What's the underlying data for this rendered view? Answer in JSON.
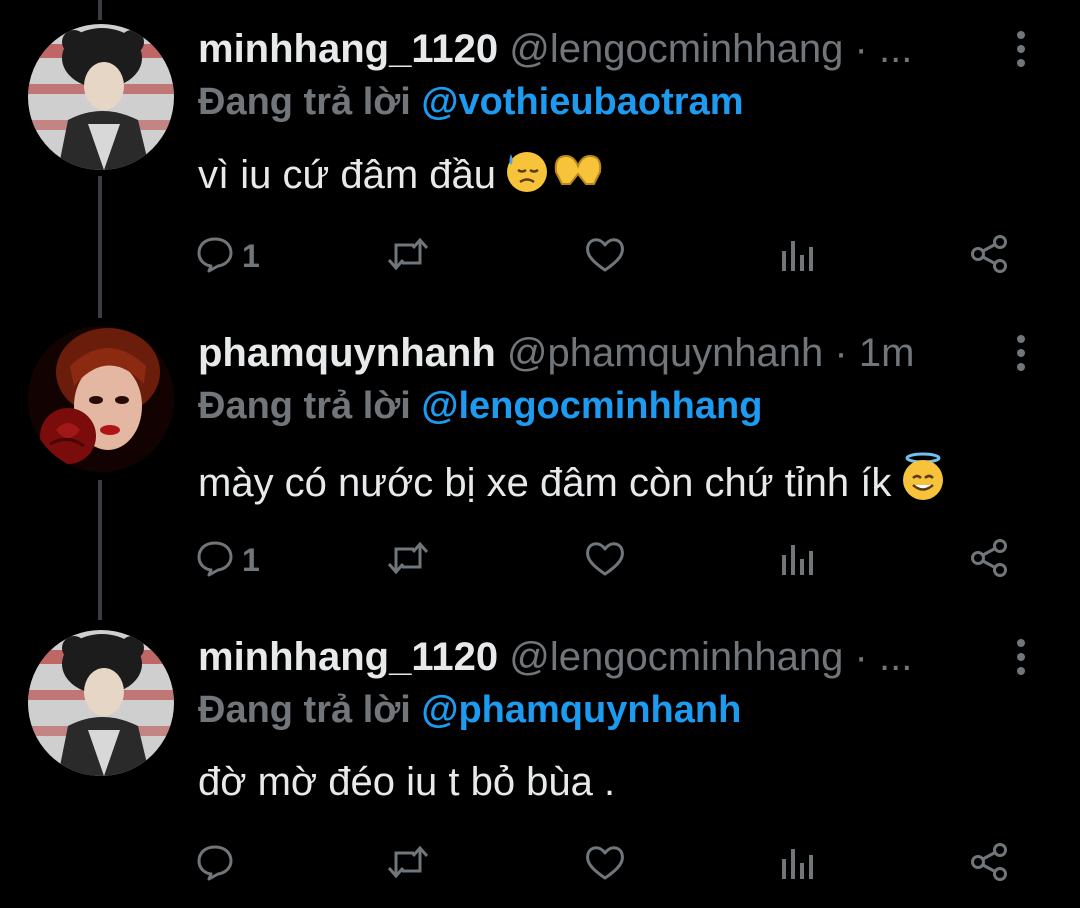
{
  "tweets": [
    {
      "display_name": "minhhang_1120",
      "handle": "@lengocminhhang",
      "separator": "·",
      "time": "...",
      "reply_label": "Đang trả lời",
      "reply_to": "@vothieubaotram",
      "text": "vì iu cứ đâm đầu",
      "emojis": [
        "downcast-sweat-face",
        "heart-hands"
      ],
      "reply_count": "1",
      "retweet_count": "",
      "like_count": "",
      "avatar": "avatar-minhhang"
    },
    {
      "display_name": "phamquynhanh",
      "handle": "@phamquynhanh",
      "separator": "·",
      "time": "1m",
      "reply_label": "Đang trả lời",
      "reply_to": "@lengocminhhang",
      "text": "mày có nước bị xe đâm còn chứ tỉnh ík",
      "emojis": [
        "smiling-face-with-halo"
      ],
      "reply_count": "1",
      "retweet_count": "",
      "like_count": "",
      "avatar": "avatar-phamquynhanh"
    },
    {
      "display_name": "minhhang_1120",
      "handle": "@lengocminhhang",
      "separator": "·",
      "time": "...",
      "reply_label": "Đang trả lời",
      "reply_to": "@phamquynhanh",
      "text": "đờ mờ đéo iu t bỏ bùa .",
      "emojis": [],
      "reply_count": "",
      "retweet_count": "",
      "like_count": "",
      "avatar": "avatar-minhhang"
    }
  ],
  "icons": {
    "reply": "reply-icon",
    "retweet": "retweet-icon",
    "like": "heart-icon",
    "views": "analytics-icon",
    "share": "share-icon",
    "more": "more-vertical-icon"
  },
  "colors": {
    "background": "#000000",
    "text_primary": "#e7e9ea",
    "text_secondary": "#71767b",
    "accent": "#1d9bf0",
    "thread_line": "#3a3d41"
  }
}
